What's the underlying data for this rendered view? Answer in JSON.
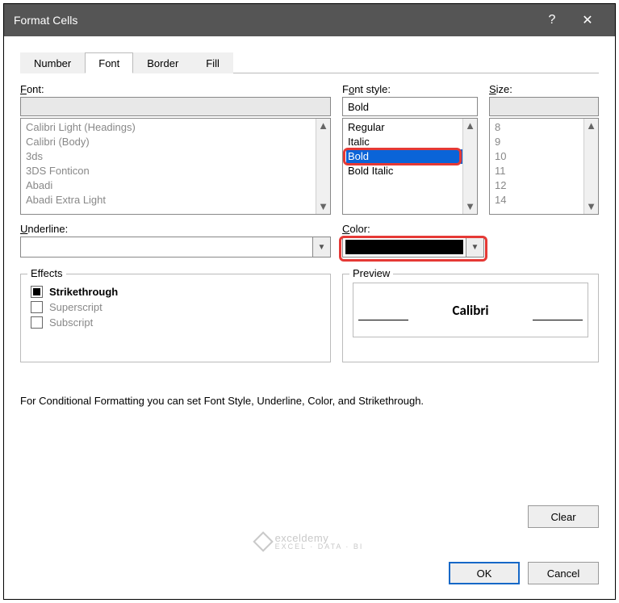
{
  "title": "Format Cells",
  "tabs": {
    "number": "Number",
    "font": "Font",
    "border": "Border",
    "fill": "Fill"
  },
  "labels": {
    "font": "Font:",
    "font_u": "F",
    "style": "Font style:",
    "style_u": "o",
    "size": "Size:",
    "size_u": "S",
    "underline": "Underline:",
    "underline_u": "U",
    "color": "Color:",
    "color_u": "C",
    "effects": "Effects",
    "preview": "Preview"
  },
  "font_list": [
    "Calibri Light (Headings)",
    "Calibri (Body)",
    "3ds",
    "3DS Fonticon",
    "Abadi",
    "Abadi Extra Light"
  ],
  "style_input": "Bold",
  "style_list": [
    "Regular",
    "Italic",
    "Bold",
    "Bold Italic"
  ],
  "style_selected": "Bold",
  "size_list": [
    "8",
    "9",
    "10",
    "11",
    "12",
    "14"
  ],
  "effects": {
    "strike": "Strikethrough",
    "super": "Superscript",
    "sub": "Subscript"
  },
  "preview_text": "Calibri",
  "color_value": "#000000",
  "note": "For Conditional Formatting you can set Font Style, Underline, Color, and Strikethrough.",
  "buttons": {
    "clear": "Clear",
    "ok": "OK",
    "cancel": "Cancel"
  },
  "watermark": {
    "main": "exceldemy",
    "sub": "EXCEL · DATA · BI"
  }
}
